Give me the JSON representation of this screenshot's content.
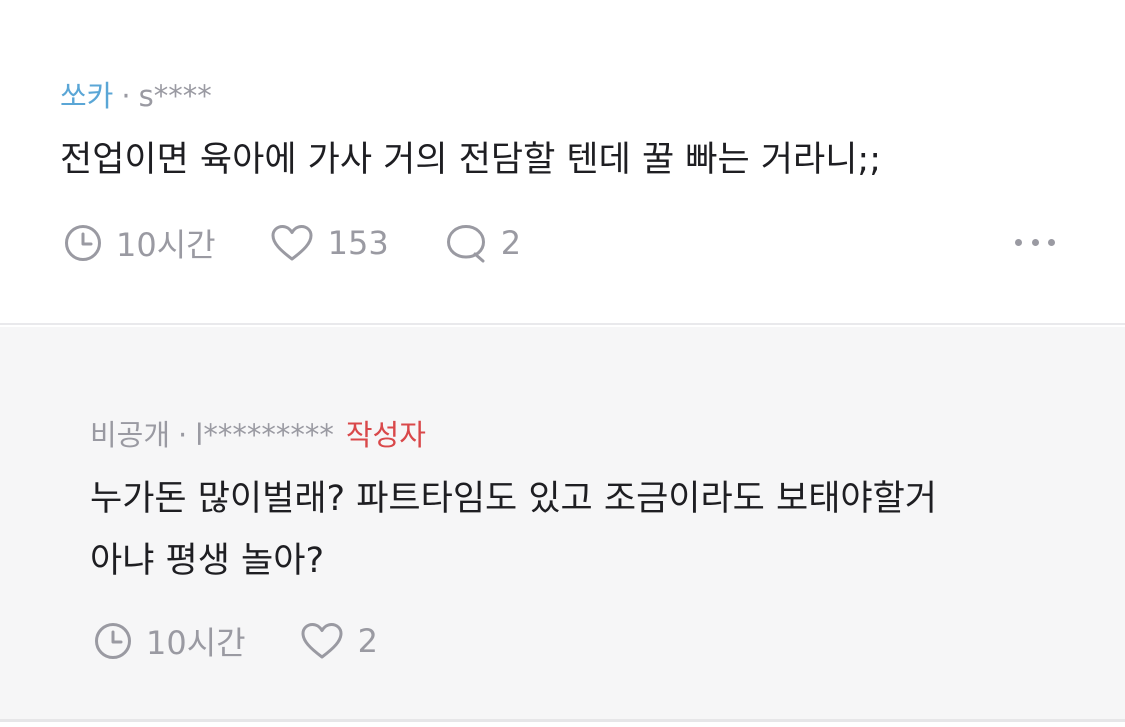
{
  "comments": [
    {
      "nickname": "쏘카",
      "separator": "·",
      "user_id": "s****",
      "text": "전업이면 육아에 가사 거의 전담할 텐데 꿀 빠는 거라니;;",
      "time": "10시간",
      "likes": "153",
      "replies": "2",
      "icons": [
        "clock-icon",
        "heart-icon",
        "comment-icon",
        "more-icon"
      ]
    },
    {
      "nickname": "비공개",
      "separator": "·",
      "user_id": "l*********",
      "badge": "작성자",
      "text_line1": "누가돈 많이벌래? 파트타임도 있고 조금이라도 보태야할거",
      "text_line2": "아냐 평생 놀아?",
      "time": "10시간",
      "likes": "2",
      "icons": [
        "clock-icon",
        "heart-icon"
      ]
    }
  ],
  "colors": {
    "nickname_blue": "#5aa6d6",
    "author_badge_red": "#d9484a",
    "meta_gray": "#9a9aa2",
    "reply_background": "#f6f6f7"
  }
}
